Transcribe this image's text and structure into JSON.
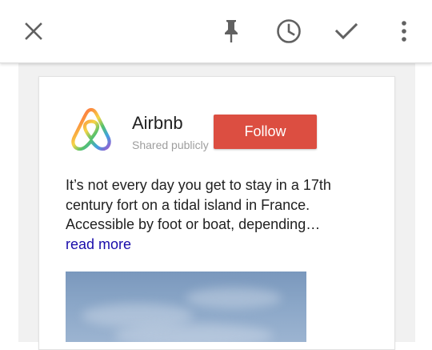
{
  "toolbar": {
    "close_icon": "close-icon",
    "pin_icon": "pin-icon",
    "history_icon": "clock-icon",
    "done_icon": "check-icon",
    "more_icon": "more-vert-icon"
  },
  "post": {
    "author": "Airbnb",
    "visibility": "Shared publicly",
    "follow_label": "Follow",
    "text": "It’s not every day you get to stay in a 17th century fort on a tidal island in France. Accessible by foot or boat, depending…",
    "read_more": "read more"
  },
  "colors": {
    "follow_bg": "#dc4e41",
    "link": "#1a0dab",
    "icon": "#616161"
  }
}
